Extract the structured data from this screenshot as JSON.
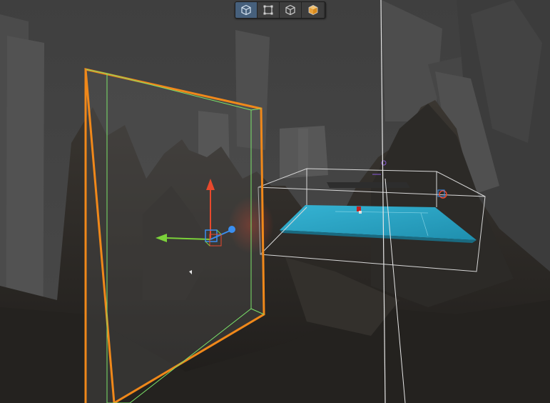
{
  "app": {
    "view": "3d-scene-viewport"
  },
  "toolbar": {
    "buttons": [
      {
        "name": "perspective-view-button",
        "icon": "cube-wireframe-icon",
        "active": true
      },
      {
        "name": "bounds-view-button",
        "icon": "bounding-rect-icon",
        "active": false
      },
      {
        "name": "wireframe-view-button",
        "icon": "cube-outline-icon",
        "active": false
      },
      {
        "name": "shaded-view-button",
        "icon": "cube-shaded-icon",
        "active": false
      }
    ]
  },
  "colors": {
    "selection_outline": "#f0881a",
    "bounds_green": "#7ce46a",
    "gizmo_x": "#e8492d",
    "gizmo_y": "#7bd23a",
    "gizmo_z": "#3a8ef0",
    "water": "#2aa0c0",
    "sky": "#3c3c3c"
  }
}
